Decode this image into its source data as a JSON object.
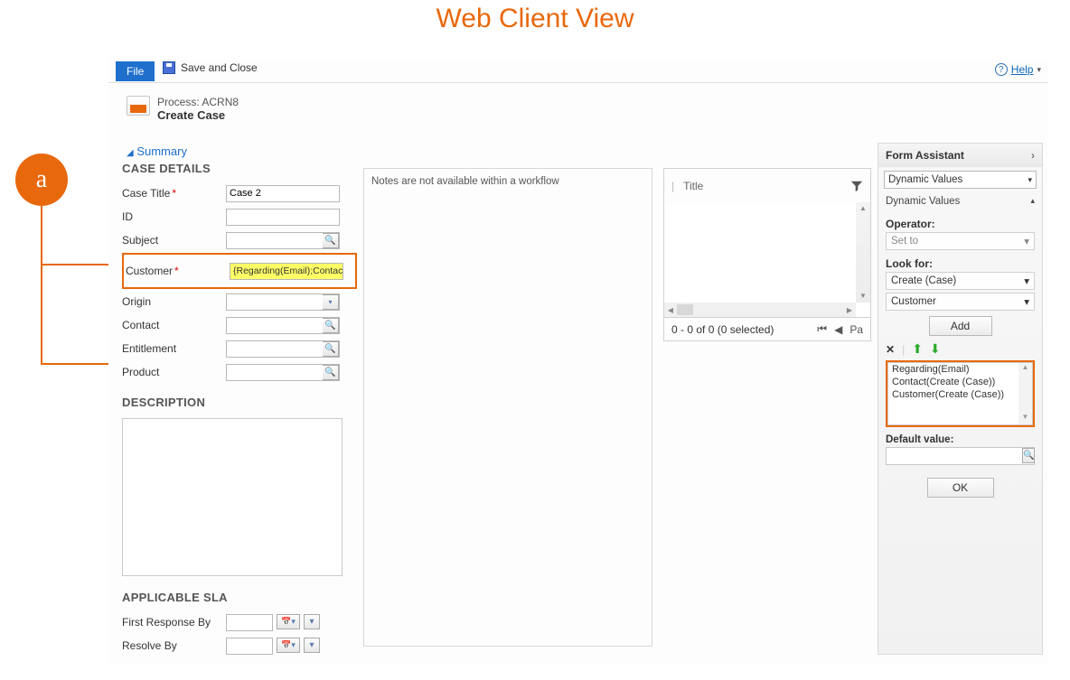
{
  "page_heading": "Web Client View",
  "annotation_badge": "a",
  "toolbar": {
    "file_label": "File",
    "save_close_label": "Save and Close",
    "help_label": "Help"
  },
  "process": {
    "line1": "Process: ACRN8",
    "line2": "Create Case"
  },
  "summary_link": "Summary",
  "sections": {
    "case_details_title": "CASE DETAILS",
    "description_title": "DESCRIPTION",
    "sla_title": "APPLICABLE SLA"
  },
  "fields": {
    "case_title": {
      "label": "Case Title",
      "value": "Case 2",
      "required": true
    },
    "id": {
      "label": "ID",
      "value": ""
    },
    "subject": {
      "label": "Subject",
      "value": ""
    },
    "customer": {
      "label": "Customer",
      "required": true,
      "value": "{Regarding(Email);Contact(Cr"
    },
    "origin": {
      "label": "Origin",
      "value": ""
    },
    "contact": {
      "label": "Contact",
      "value": ""
    },
    "entitlement": {
      "label": "Entitlement",
      "value": ""
    },
    "product": {
      "label": "Product",
      "value": ""
    },
    "first_response_by": {
      "label": "First Response By",
      "value": ""
    },
    "resolve_by": {
      "label": "Resolve By",
      "value": ""
    }
  },
  "notes_message": "Notes are not available within a workflow",
  "grid": {
    "title_col": "Title",
    "status_text": "0 - 0 of 0 (0 selected)",
    "page_label": "Pa"
  },
  "form_assistant": {
    "header": "Form Assistant",
    "mode": "Dynamic Values",
    "section": "Dynamic Values",
    "operator_label": "Operator:",
    "operator_value": "Set to",
    "lookfor_label": "Look for:",
    "lookfor_entity": "Create (Case)",
    "lookfor_attr": "Customer",
    "add_label": "Add",
    "list_items": [
      "Regarding(Email)",
      "Contact(Create (Case))",
      "Customer(Create (Case))"
    ],
    "default_label": "Default value:",
    "ok_label": "OK"
  }
}
